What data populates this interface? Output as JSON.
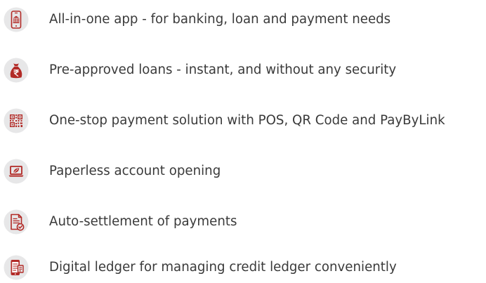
{
  "colors": {
    "accent": "#b22a26",
    "circle": "#e7e7e8",
    "text": "#3a3a3a"
  },
  "features": [
    {
      "icon": "mobile-bank-icon",
      "text": "All-in-one app - for banking, loan and payment needs"
    },
    {
      "icon": "rupee-money-bag-icon",
      "text": "Pre-approved loans -  instant, and without any security"
    },
    {
      "icon": "qr-code-icon",
      "text": "One-stop payment solution with POS, QR Code and PayByLink"
    },
    {
      "icon": "laptop-leaf-icon",
      "text": "Paperless account opening"
    },
    {
      "icon": "document-check-icon",
      "text": "Auto-settlement of payments"
    },
    {
      "icon": "phone-ledger-icon",
      "text": "Digital ledger for managing credit ledger conveniently"
    }
  ]
}
